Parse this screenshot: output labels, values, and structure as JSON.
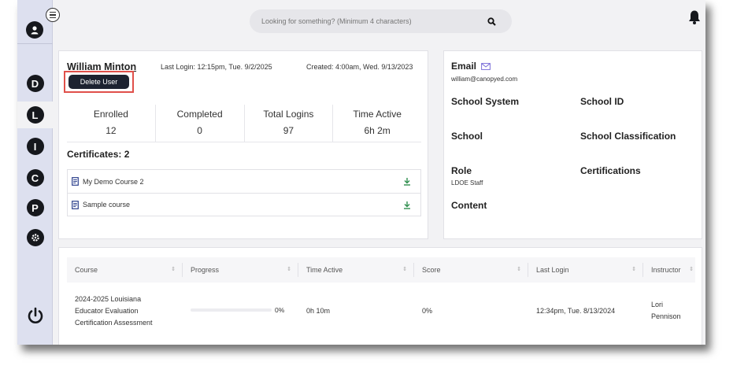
{
  "sidebar": {
    "items": [
      {
        "letter": "D",
        "active": false
      },
      {
        "letter": "L",
        "active": true
      },
      {
        "letter": "I",
        "active": false
      },
      {
        "letter": "C",
        "active": false
      },
      {
        "letter": "P",
        "active": false
      }
    ]
  },
  "search": {
    "placeholder": "Looking for something? (Minimum 4 characters)"
  },
  "user": {
    "name": "William Minton",
    "last_login": "Last Login: 12:15pm, Tue. 9/2/2025",
    "created": "Created: 4:00am, Wed. 9/13/2023",
    "delete_label": "Delete User"
  },
  "stats": [
    {
      "label": "Enrolled",
      "value": "12"
    },
    {
      "label": "Completed",
      "value": "0"
    },
    {
      "label": "Total Logins",
      "value": "97"
    },
    {
      "label": "Time Active",
      "value": "6h 2m"
    }
  ],
  "certificates": {
    "title": "Certificates: 2",
    "items": [
      "My Demo Course 2",
      "Sample course"
    ]
  },
  "info": {
    "email_label": "Email",
    "email_value": "william@canopyed.com",
    "school_system": "School System",
    "school_id": "School ID",
    "school": "School",
    "school_classification": "School Classification",
    "role": "Role",
    "role_value": "LDOE Staff",
    "certifications": "Certifications",
    "content": "Content"
  },
  "table": {
    "headers": [
      "Course",
      "Progress",
      "Time Active",
      "Score",
      "Last Login",
      "Instructor"
    ],
    "rows": [
      {
        "course": [
          "2024-2025 Louisiana",
          "Educator Evaluation",
          "Certification Assessment"
        ],
        "progress": 0,
        "progress_label": "0%",
        "time_active": "0h 10m",
        "score": "0%",
        "last_login": "12:34pm, Tue. 8/13/2024",
        "instructor": [
          "Lori",
          "Pennison"
        ]
      }
    ]
  }
}
